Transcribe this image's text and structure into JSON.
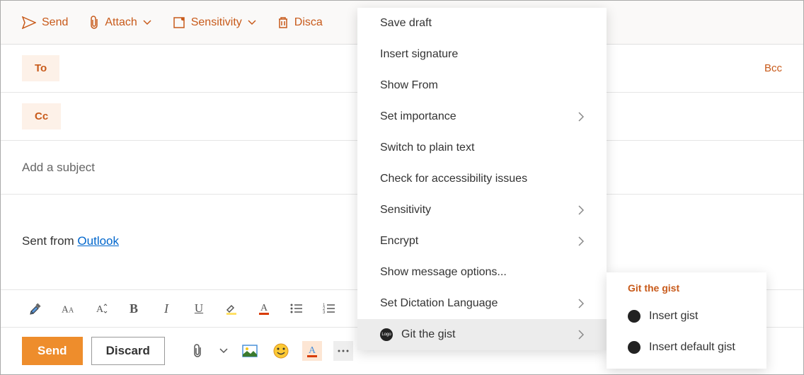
{
  "toolbar": {
    "send": "Send",
    "attach": "Attach",
    "sensitivity": "Sensitivity",
    "discard": "Discard"
  },
  "recipients": {
    "to": "To",
    "cc": "Cc",
    "bcc": "Bcc"
  },
  "subject_placeholder": "Add a subject",
  "body": {
    "signature_prefix": "Sent from ",
    "signature_link": "Outlook"
  },
  "bottom": {
    "send": "Send",
    "discard": "Discard"
  },
  "menu": {
    "items": [
      {
        "label": "Save draft",
        "submenu": false
      },
      {
        "label": "Insert signature",
        "submenu": false
      },
      {
        "label": "Show From",
        "submenu": false
      },
      {
        "label": "Set importance",
        "submenu": true
      },
      {
        "label": "Switch to plain text",
        "submenu": false
      },
      {
        "label": "Check for accessibility issues",
        "submenu": false
      },
      {
        "label": "Sensitivity",
        "submenu": true
      },
      {
        "label": "Encrypt",
        "submenu": true
      },
      {
        "label": "Show message options...",
        "submenu": false
      },
      {
        "label": "Set Dictation Language",
        "submenu": true
      },
      {
        "label": "Git the gist",
        "submenu": true,
        "icon": true,
        "highlighted": true
      }
    ]
  },
  "submenu": {
    "title": "Git the gist",
    "items": [
      {
        "label": "Insert gist"
      },
      {
        "label": "Insert default gist"
      }
    ]
  }
}
